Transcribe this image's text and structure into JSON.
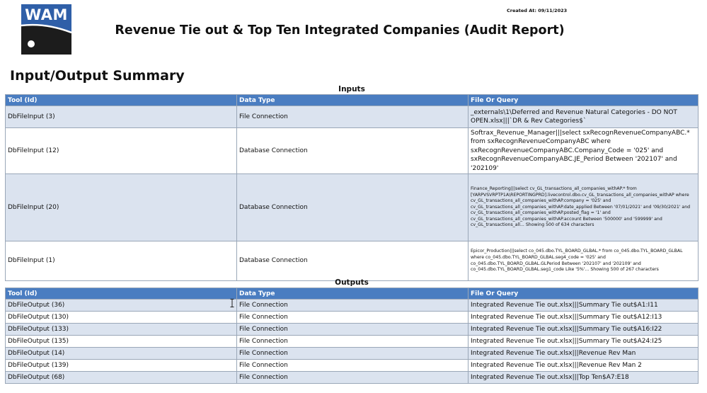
{
  "header": {
    "logo_text": "WAM",
    "created_at": "Created At: 09/11/2023",
    "title": "Revenue Tie out & Top Ten Integrated Companies (Audit Report)"
  },
  "section_title": "Input/Output Summary",
  "inputs": {
    "caption": "Inputs",
    "columns": [
      "Tool (Id)",
      "Data Type",
      "File Or Query"
    ],
    "rows": [
      {
        "tool": "DbFileInput (3)",
        "type": "File Connection",
        "query": "_externals\\1\\Deferred and Revenue Natural Categories - DO NOT OPEN.xlsx|||`DR & Rev Categories$`"
      },
      {
        "tool": "DbFileInput (12)",
        "type": "Database Connection",
        "query": "Softrax_Revenue_Manager|||select sxRecognRevenueCompanyABC.* from sxRecognRevenueCompanyABC where sxRecognRevenueCompanyABC.Company_Code = '025' and sxRecognRevenueCompanyABC.JE_Period Between '202107' and '202109'"
      },
      {
        "tool": "DbFileInput (20)",
        "type": "Database Connection",
        "query": "Finance_Reporting|||select cv_GL_transactions_all_companies_withAP.* from [YARPVSVRPTP1A\\REPORTINGPRD].livecontrol.dbo.cv_GL_transactions_all_companies_withAP where cv_GL_transactions_all_companies_withAP.company = '025' and cv_GL_transactions_all_companies_withAP.date_applied Between '07/01/2021' and '09/30/2021' and cv_GL_transactions_all_companies_withAP.posted_flag = '1' and cv_GL_transactions_all_companies_withAP.account Between '500000' and '599999' and cv_GL_transactions_all... Showing 500 of 634 characters"
      },
      {
        "tool": "DbFileInput (1)",
        "type": "Database Connection",
        "query": "Epicor_Production|||select co_045.dbo.TYL_BOARD_GLBAL.* from co_045.dbo.TYL_BOARD_GLBAL where co_045.dbo.TYL_BOARD_GLBAL.seg4_code = '025' and co_045.dbo.TYL_BOARD_GLBAL.GLPeriod Between '202107' and '202109' and co_045.dbo.TYL_BOARD_GLBAL.seg1_code Like '5%'... Showing 500 of 267 characters"
      }
    ]
  },
  "outputs": {
    "caption": "Outputs",
    "columns": [
      "Tool (Id)",
      "Data Type",
      "File Or Query"
    ],
    "rows": [
      {
        "tool": "DbFileOutput (36)",
        "type": "File Connection",
        "query": "Integrated Revenue Tie out.xlsx|||Summary Tie out$A1:I11"
      },
      {
        "tool": "DbFileOutput (130)",
        "type": "File Connection",
        "query": "Integrated Revenue Tie out.xlsx|||Summary Tie out$A12:I13"
      },
      {
        "tool": "DbFileOutput (133)",
        "type": "File Connection",
        "query": "Integrated Revenue Tie out.xlsx|||Summary Tie out$A16:I22"
      },
      {
        "tool": "DbFileOutput (135)",
        "type": "File Connection",
        "query": "Integrated Revenue Tie out.xlsx|||Summary Tie out$A24:I25"
      },
      {
        "tool": "DbFileOutput (14)",
        "type": "File Connection",
        "query": "Integrated Revenue Tie out.xlsx|||Revenue Rev Man"
      },
      {
        "tool": "DbFileOutput (139)",
        "type": "File Connection",
        "query": "Integrated Revenue Tie out.xlsx|||Revenue Rev Man 2"
      },
      {
        "tool": "DbFileOutput (68)",
        "type": "File Connection",
        "query": "Integrated Revenue Tie out.xlsx|||Top Ten$A7:E18"
      }
    ]
  },
  "colors": {
    "header_bg": "#4a7dc1",
    "alt_row": "#dbe3ef",
    "logo_bg": "#2f5fa8"
  }
}
